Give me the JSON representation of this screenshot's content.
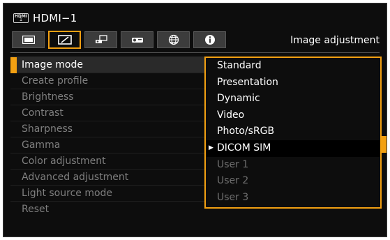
{
  "header": {
    "hdmi_logo_top": "HDMI",
    "hdmi_logo_bottom": "1",
    "source_name": "HDMI−1",
    "panel_title": "Image adjustment"
  },
  "tabs": [
    {
      "icon": "picture-icon",
      "active": false
    },
    {
      "icon": "image-adjust-icon",
      "active": true
    },
    {
      "icon": "installation-icon",
      "active": false
    },
    {
      "icon": "projector-icon",
      "active": false
    },
    {
      "icon": "network-icon",
      "active": false
    },
    {
      "icon": "info-icon",
      "active": false
    }
  ],
  "menu": {
    "items": [
      {
        "label": "Image mode",
        "enabled": true,
        "selected": true
      },
      {
        "label": "Create profile",
        "enabled": false
      },
      {
        "label": "Brightness",
        "enabled": false
      },
      {
        "label": "Contrast",
        "enabled": false
      },
      {
        "label": "Sharpness",
        "enabled": false
      },
      {
        "label": "Gamma",
        "enabled": false
      },
      {
        "label": "Color adjustment",
        "enabled": false
      },
      {
        "label": "Advanced adjustment",
        "enabled": false
      },
      {
        "label": "Light source mode",
        "enabled": false
      },
      {
        "label": "Reset",
        "enabled": false
      }
    ]
  },
  "dropdown": {
    "options": [
      {
        "label": "Standard",
        "enabled": true
      },
      {
        "label": "Presentation",
        "enabled": true
      },
      {
        "label": "Dynamic",
        "enabled": true
      },
      {
        "label": "Video",
        "enabled": true
      },
      {
        "label": "Photo/sRGB",
        "enabled": true
      },
      {
        "label": "DICOM SIM",
        "enabled": true,
        "current": true
      },
      {
        "label": "User 1",
        "enabled": false
      },
      {
        "label": "User 2",
        "enabled": false
      },
      {
        "label": "User 3",
        "enabled": false
      }
    ],
    "current_marker": "▶"
  },
  "colors": {
    "accent": "#f2a012",
    "background": "#0d0d0d",
    "text": "#ffffff",
    "disabled_text": "#7f7f7f"
  }
}
